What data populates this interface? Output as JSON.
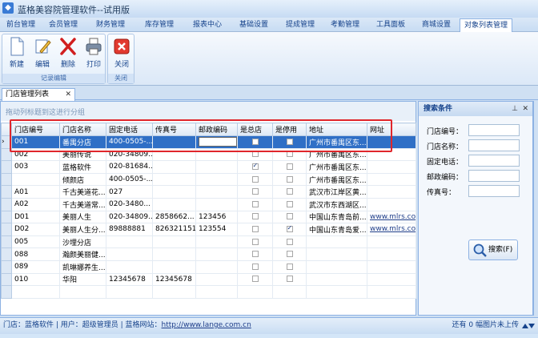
{
  "app": {
    "title": "蓝格美容院管理软件--试用版"
  },
  "menu": {
    "tabs": [
      "前台管理",
      "会员管理",
      "财务管理",
      "库存管理",
      "报表中心",
      "基础设置",
      "提成管理",
      "考勤管理",
      "工具面板",
      "商城设置",
      "对象列表管理"
    ],
    "active": "对象列表管理"
  },
  "ribbon": {
    "groups": [
      {
        "label": "记录编辑",
        "buttons": [
          "新建",
          "编辑",
          "删除",
          "打印"
        ]
      },
      {
        "label": "关闭",
        "buttons": [
          "关闭"
        ]
      }
    ]
  },
  "doc_tab": {
    "label": "门店管理列表"
  },
  "grid": {
    "group_hint": "拖动列标题到这进行分组",
    "columns": [
      "门店编号",
      "门店名称",
      "固定电话",
      "传真号",
      "邮政编码",
      "是总店",
      "是停用",
      "地址",
      "网址"
    ],
    "rows": [
      [
        "001",
        "番禺分店",
        "400-0505-...",
        "",
        "",
        false,
        false,
        "广州市番禺区东...",
        ""
      ],
      [
        "002",
        "美丽传说",
        "020-34809...",
        "",
        "",
        false,
        false,
        "广州市番禺区东...",
        ""
      ],
      [
        "003",
        "蓝格软件",
        "020-81684...",
        "",
        "",
        true,
        false,
        "广州市番禺区东...",
        ""
      ],
      [
        "",
        "倾颜店",
        "400-0505-...",
        "",
        "",
        false,
        false,
        "广州市番禺区东...",
        ""
      ],
      [
        "A01",
        "千古美道花...",
        "027",
        "",
        "",
        false,
        false,
        "武汉市江岸区黄...",
        ""
      ],
      [
        "A02",
        "千古美道常...",
        "020-3480...",
        "",
        "",
        false,
        false,
        "武汉市东西湖区...",
        ""
      ],
      [
        "D01",
        "美丽人生",
        "020-34809...",
        "2858662...",
        "123456",
        false,
        false,
        "中国山东青岛前...",
        "www.mlrs.com"
      ],
      [
        "D02",
        "美丽人生分...",
        "89888881",
        "826321151",
        "123554",
        false,
        true,
        "中国山东青岛爱...",
        "www.mlrs.com"
      ],
      [
        "005",
        "沙埋分店",
        "",
        "",
        "",
        false,
        false,
        "",
        ""
      ],
      [
        "088",
        "瀚颜美丽健...",
        "",
        "",
        "",
        false,
        false,
        "",
        ""
      ],
      [
        "089",
        "凯琳娜养生...",
        "",
        "",
        "",
        false,
        false,
        "",
        ""
      ],
      [
        "010",
        "华阳",
        "12345678",
        "12345678",
        "",
        false,
        false,
        "",
        ""
      ]
    ]
  },
  "search": {
    "title": "搜索条件",
    "fields": [
      "门店编号：",
      "门店名称：",
      "固定电话：",
      "邮政编码：",
      "传真号："
    ],
    "button": "搜索(F)"
  },
  "status": {
    "left_prefix": "门店：蓝格软件 | 用户：超级管理员 | 蓝格网站：",
    "link": "http://www.lange.com.cn",
    "right": "还有 0 幅图片未上传"
  }
}
